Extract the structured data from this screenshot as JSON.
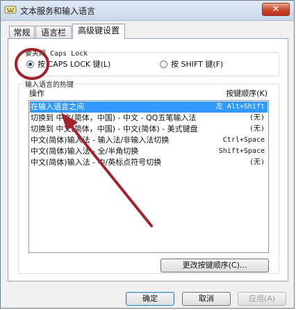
{
  "window": {
    "title": "文本服务和输入语言",
    "close_glyph": "✕"
  },
  "tabs": [
    {
      "label": "常规",
      "active": false
    },
    {
      "label": "语言栏",
      "active": false
    },
    {
      "label": "高级键设置",
      "active": true
    }
  ],
  "caps_lock": {
    "group_label": "要关闭 Caps Lock",
    "options": [
      {
        "label": "按 CAPS LOCK 键(L)",
        "selected": true
      },
      {
        "label": "按 SHIFT 键(F)",
        "selected": false
      }
    ]
  },
  "hotkeys": {
    "group_label": "输入语言的热键",
    "col_action": "操作",
    "col_key": "按键顺序(K)",
    "rows": [
      {
        "action": "在输入语言之间",
        "key": "左 Alt+Shift",
        "selected": true
      },
      {
        "action": "切换到 中文(简体，中国) - 中文 - QQ五笔输入法",
        "key": "(无)",
        "selected": false
      },
      {
        "action": "切换到 中文(简体，中国) - 中文(简体) - 美式键盘",
        "key": "(无)",
        "selected": false
      },
      {
        "action": "中文(简体)输入法 - 输入法/非输入法切换",
        "key": "Ctrl+Space",
        "selected": false
      },
      {
        "action": "中文(简体)输入法 - 全/半角切换",
        "key": "Shift+Space",
        "selected": false
      },
      {
        "action": "中文(简体)输入法 - 中/英标点符号切换",
        "key": "(无)",
        "selected": false
      }
    ],
    "change_button": "更改按键顺序(C)..."
  },
  "footer": {
    "ok": "确定",
    "cancel": "取消",
    "apply": "应用(A)"
  },
  "annotation_color": "#a3232b",
  "selection_color": "#3399ff"
}
